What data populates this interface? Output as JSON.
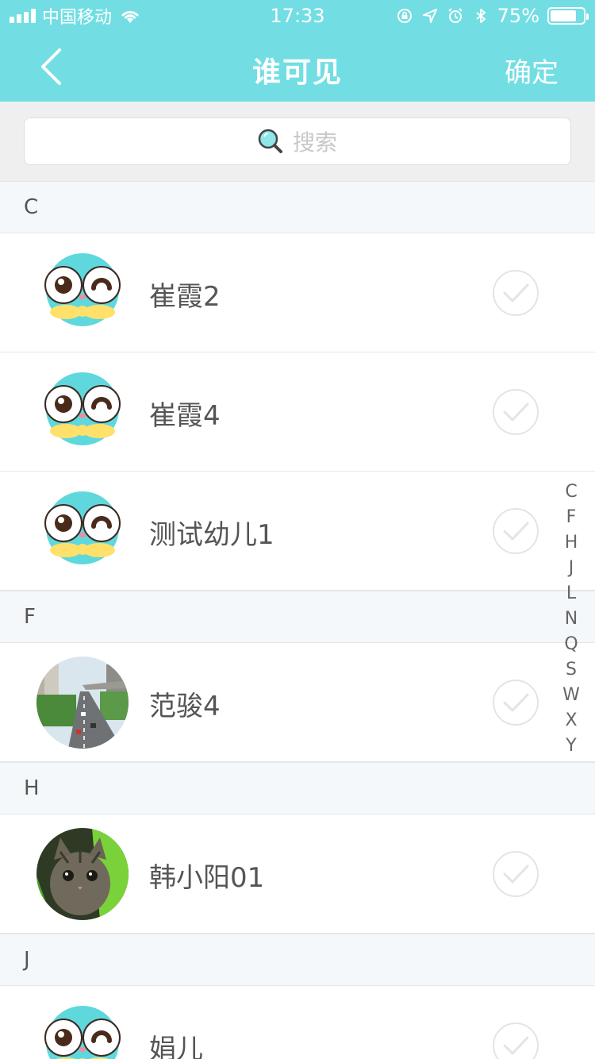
{
  "status_bar": {
    "carrier": "中国移动",
    "time": "17:33",
    "battery": "75%",
    "battery_level": 0.75
  },
  "nav": {
    "title": "谁可见",
    "confirm": "确定",
    "back_icon": "chevron-left-icon"
  },
  "search": {
    "placeholder": "搜索",
    "icon": "search-icon"
  },
  "sections": [
    {
      "letter": "C",
      "items": [
        {
          "name": "崔霞2",
          "avatar": "cartoon"
        },
        {
          "name": "崔霞4",
          "avatar": "cartoon"
        },
        {
          "name": "测试幼儿1",
          "avatar": "cartoon"
        }
      ]
    },
    {
      "letter": "F",
      "items": [
        {
          "name": "范骏4",
          "avatar": "street-photo"
        }
      ]
    },
    {
      "letter": "H",
      "items": [
        {
          "name": "韩小阳01",
          "avatar": "cat-photo"
        }
      ]
    },
    {
      "letter": "J",
      "items": [
        {
          "name": "娟儿",
          "avatar": "cartoon"
        }
      ]
    }
  ],
  "index_letters": [
    "C",
    "F",
    "H",
    "J",
    "L",
    "N",
    "Q",
    "S",
    "W",
    "X",
    "Y"
  ],
  "colors": {
    "accent": "#72dee3",
    "section_bg": "#f5f8fa",
    "check": "#e4e4e4"
  }
}
